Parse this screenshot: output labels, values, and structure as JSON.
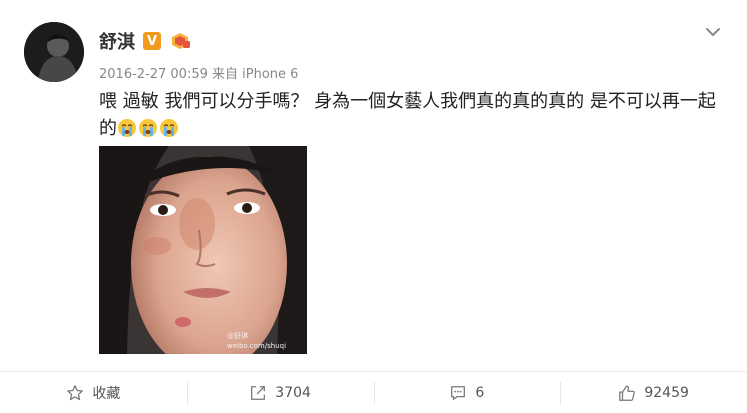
{
  "user": {
    "name": "舒淇",
    "verified_label": "V"
  },
  "post": {
    "meta": "2016-2-27 00:59 来自 iPhone 6",
    "text_main": "喂 過敏 我們可以分手嗎？ 身為一個女藝人我們真的真的真的 是不可以再一起",
    "text_end": "的"
  },
  "photo": {
    "watermark_name": "@舒淇",
    "watermark_url": "weibo.com/shuqi"
  },
  "actions": {
    "favorite_label": "收藏",
    "repost_count": "3704",
    "comment_count": "6",
    "like_count": "92459"
  },
  "icons": {
    "chevron": "chevron-down-icon",
    "star": "star-icon",
    "repost": "repost-icon",
    "comment": "comment-icon",
    "like": "thumbs-up-icon"
  },
  "colors": {
    "badge": "#f29a1f",
    "footer_text": "#555555"
  }
}
